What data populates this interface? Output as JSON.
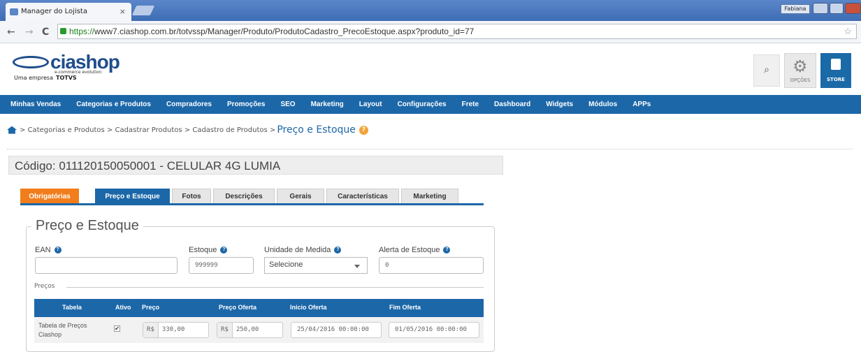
{
  "browser": {
    "tab_title": "Manager do Lojista",
    "tab_close": "×",
    "user": "Fabiana",
    "url_scheme": "https://",
    "url_rest": "www7.ciashop.com.br/totvssp/Manager/Produto/ProdutoCadastro_PrecoEstoque.aspx?produto_id=77",
    "back": "←",
    "forward": "→",
    "reload": "C",
    "star": "☆"
  },
  "header": {
    "logo_text": "ciashop",
    "logo_sub": "e-commerce evolution",
    "logo_tag": "Uma empresa",
    "logo_tag_brand": "TOTVS",
    "search_icon": "⌕",
    "opcoes_label": "OPÇÕES",
    "store_label": "STORE"
  },
  "nav": {
    "items": [
      "Minhas Vendas",
      "Categorias e Produtos",
      "Compradores",
      "Promoções",
      "SEO",
      "Marketing",
      "Layout",
      "Configurações",
      "Frete",
      "Dashboard",
      "Widgets",
      "Módulos",
      "APPs"
    ]
  },
  "breadcrumb": {
    "items": [
      "Categorias e Produtos",
      "Cadastrar Produtos",
      "Cadastro de Produtos"
    ],
    "separator": ">",
    "current": "Preço e Estoque",
    "help": "?"
  },
  "product": {
    "title": "Código: 011120150050001 - CELULAR 4G LUMIA"
  },
  "tabs": [
    "Obrigatórias",
    "Preço e Estoque",
    "Fotos",
    "Descrições",
    "Gerais",
    "Características",
    "Marketing"
  ],
  "form": {
    "legend": "Preço e Estoque",
    "ean_label": "EAN",
    "ean_value": "",
    "estoque_label": "Estoque",
    "estoque_value": "999999",
    "unidade_label": "Unidade de Medida",
    "unidade_value": "Selecione",
    "alerta_label": "Alerta de Estoque",
    "alerta_value": "0",
    "help": "?"
  },
  "precos": {
    "label": "Preços",
    "columns": [
      "Tabela",
      "Ativo",
      "Preço",
      "Preço Oferta",
      "Inicio Oferta",
      "Fim Oferta"
    ],
    "rows": [
      {
        "tabela": "Tabela de Preços Ciashop",
        "ativo": true,
        "ativo_mark": "✔",
        "currency": "R$",
        "preco": "330,00",
        "preco_oferta": "250,00",
        "inicio_oferta": "25/04/2016 00:00:00",
        "fim_oferta": "01/05/2016 00:00:00"
      }
    ]
  },
  "colors": {
    "primary": "#1c67a8",
    "orange_tab": "#f27d1c",
    "help_orange": "#f2a43a"
  }
}
